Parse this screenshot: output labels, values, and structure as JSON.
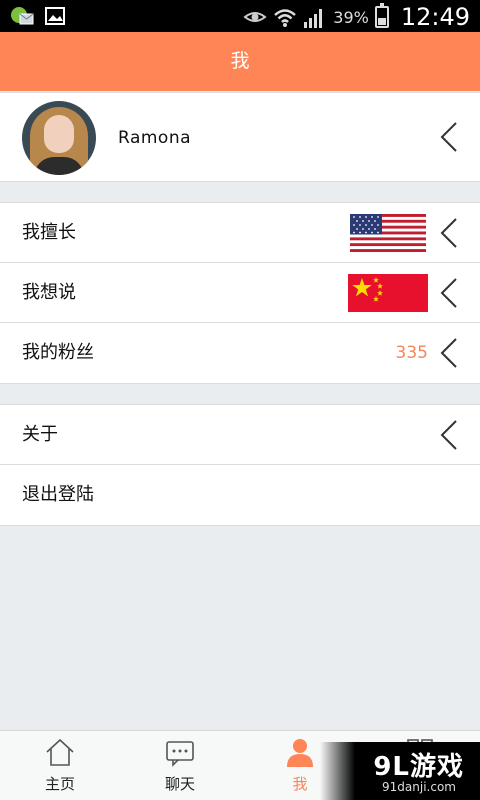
{
  "status_bar": {
    "battery_percent": "39%",
    "time": "12:49",
    "icons": [
      "app-notification-icon",
      "image-icon",
      "eye-icon",
      "wifi-icon",
      "signal-icon",
      "battery-icon"
    ]
  },
  "header": {
    "title": "我"
  },
  "profile": {
    "username": "Ramona"
  },
  "group1": {
    "items": [
      {
        "label": "我擅长",
        "flag": "us-flag-icon"
      },
      {
        "label": "我想说",
        "flag": "cn-flag-icon"
      },
      {
        "label": "我的粉丝",
        "count": "335"
      }
    ]
  },
  "group2": {
    "items": [
      {
        "label": "关于"
      },
      {
        "label": "退出登陆"
      }
    ]
  },
  "tabs": [
    {
      "label": "主页",
      "icon": "home-icon"
    },
    {
      "label": "聊天",
      "icon": "chat-icon"
    },
    {
      "label": "我",
      "icon": "person-icon",
      "active": true
    }
  ],
  "watermark": {
    "main": "9L游戏",
    "sub": "91danji.com"
  },
  "colors": {
    "accent": "#ff8456",
    "count": "#f2885a",
    "background": "#eaedf0"
  }
}
